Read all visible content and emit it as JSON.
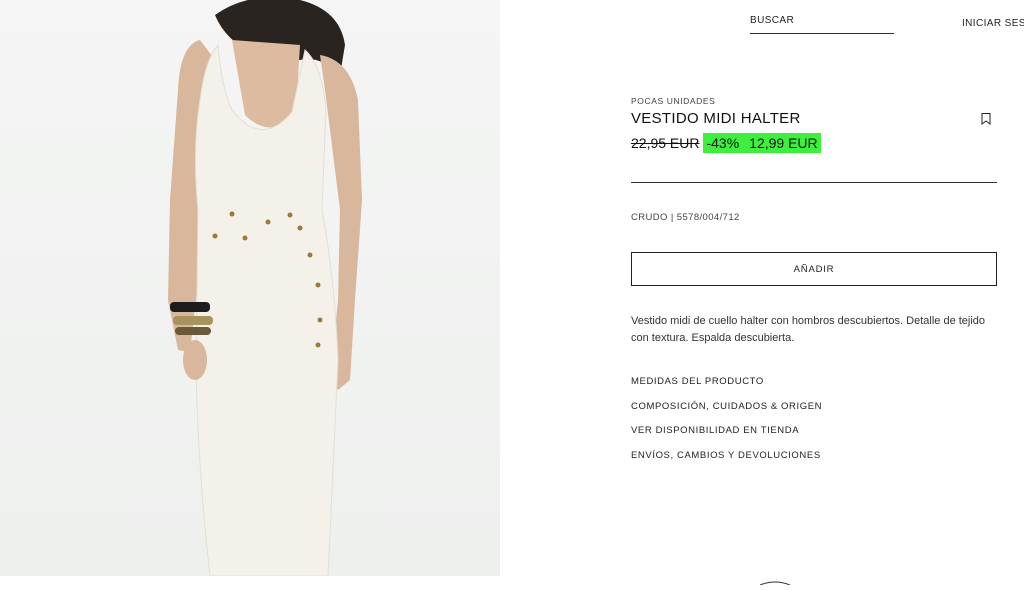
{
  "header": {
    "search_label": "BUSCAR",
    "login_label": "INICIAR SESI"
  },
  "product": {
    "stock_badge": "POCAS UNIDADES",
    "title": "VESTIDO MIDI HALTER",
    "old_price": "22,95 EUR",
    "discount": "-43%",
    "sale_price": "12,99 EUR",
    "highlight_color": "#3cf03c",
    "color_ref": "CRUDO | 5578/004/712",
    "add_label": "AÑADIR",
    "description": "Vestido midi de cuello halter con hombros descubiertos. Detalle de tejido con textura. Espalda descubierta.",
    "links": [
      "MEDIDAS DEL PRODUCTO",
      "COMPOSICIÓN, CUIDADOS & ORIGEN",
      "VER DISPONIBILIDAD EN TIENDA",
      "ENVÍOS, CAMBIOS Y DEVOLUCIONES"
    ]
  },
  "icons": {
    "bookmark": "bookmark-icon"
  }
}
